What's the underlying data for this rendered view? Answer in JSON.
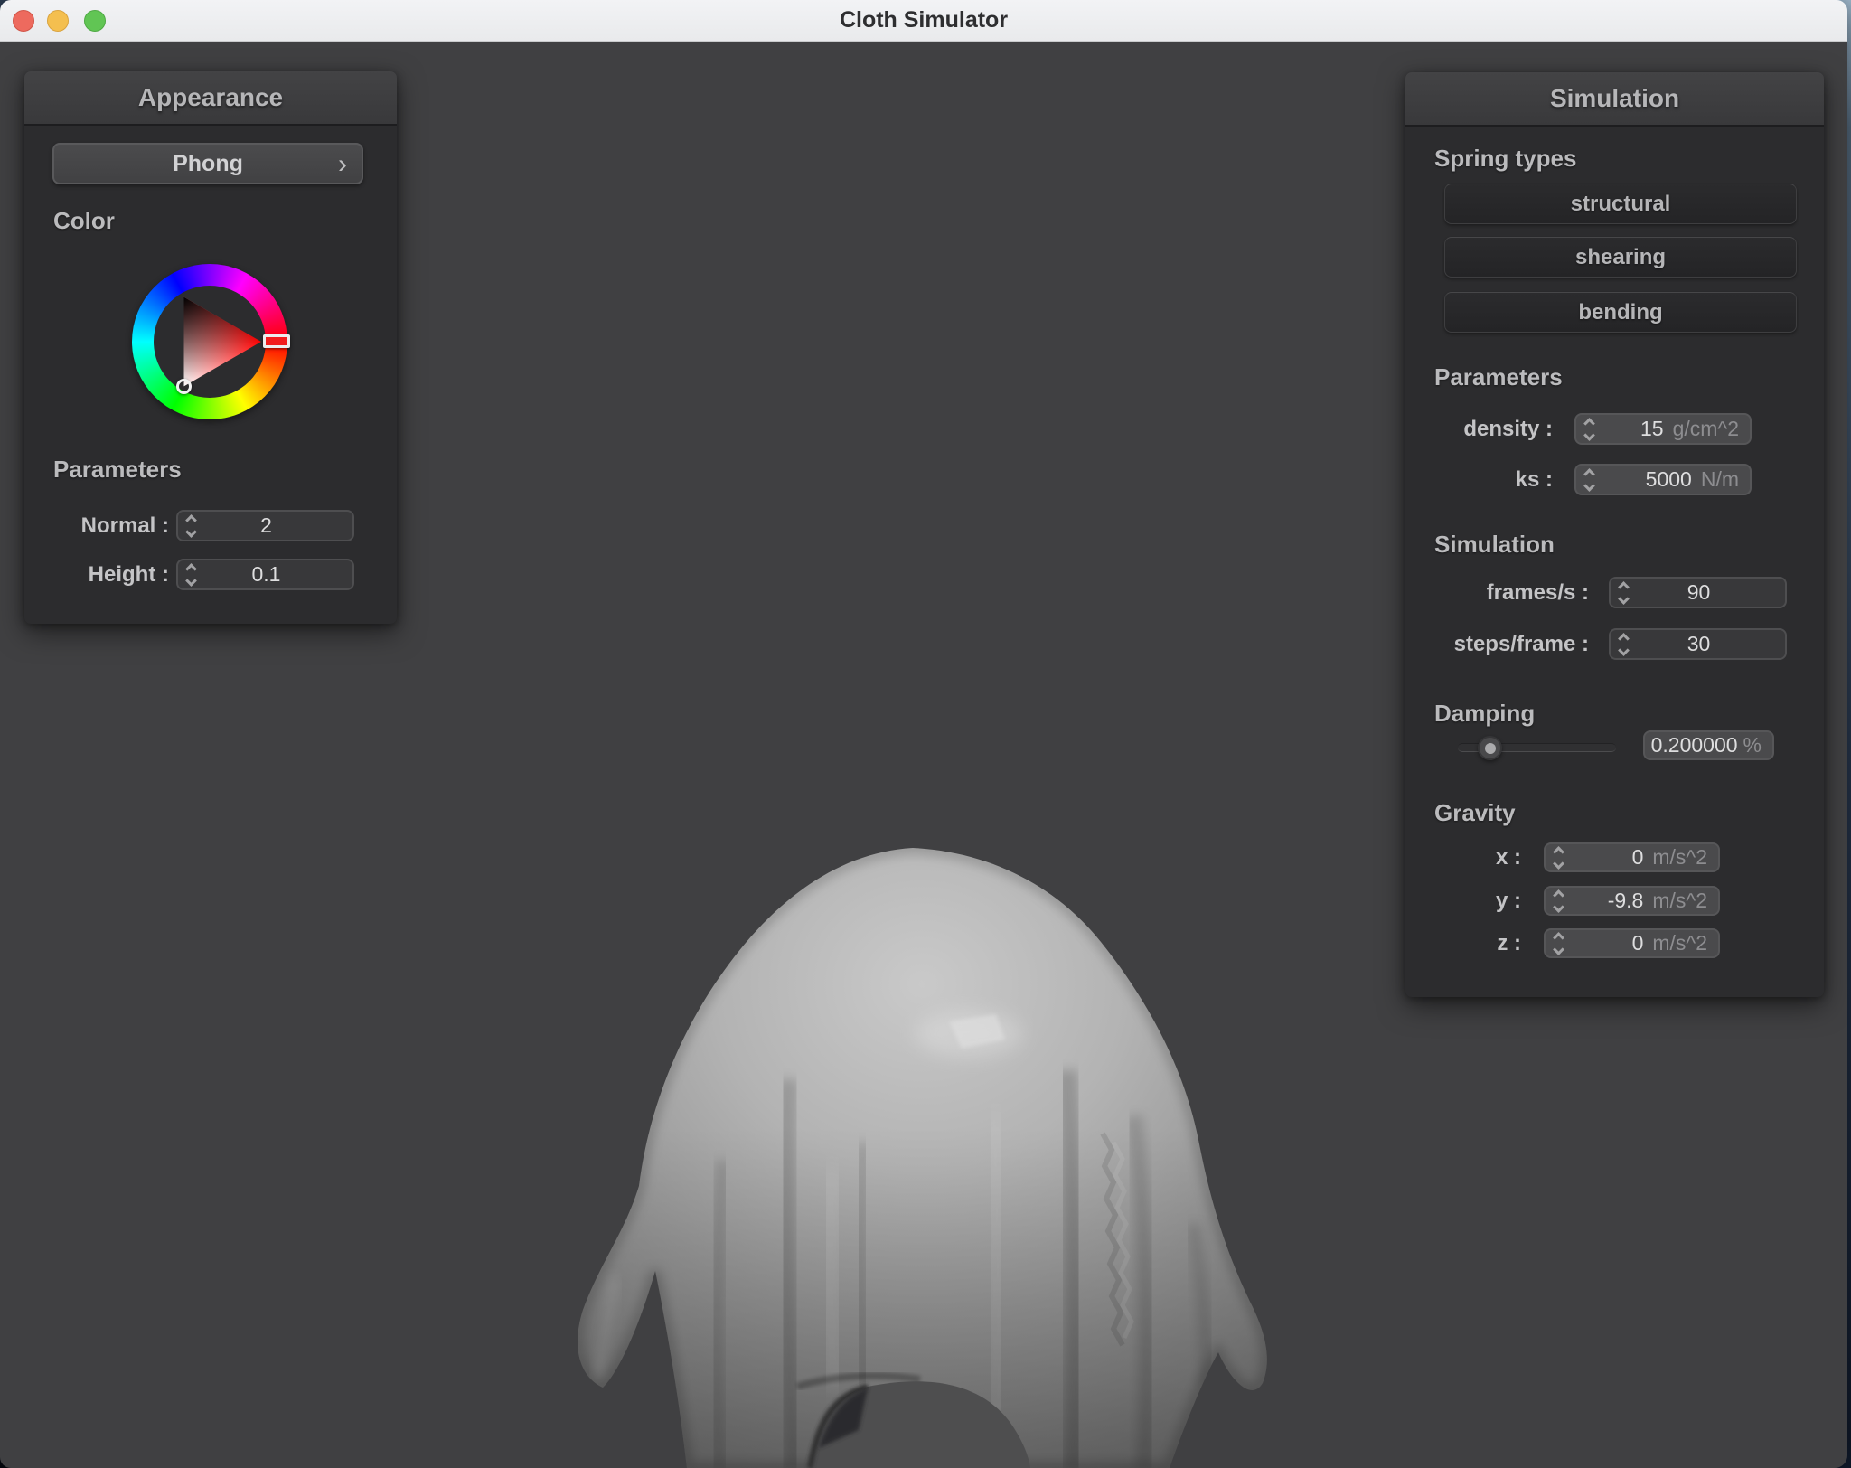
{
  "titlebar": {
    "title": "Cloth Simulator",
    "traffic_lights": {
      "close": "#ed6a5e",
      "minimize": "#f4bf4f",
      "zoom": "#61c554"
    }
  },
  "appearance": {
    "title": "Appearance",
    "shader": {
      "label": "Phong",
      "chevron": "›"
    },
    "color_label": "Color",
    "color_picker": {
      "selected_hue_color": "#f21d1d",
      "triangle_corners": [
        "hue",
        "black",
        "white"
      ]
    },
    "parameters_label": "Parameters",
    "normal": {
      "label": "Normal :",
      "value": "2"
    },
    "height": {
      "label": "Height :",
      "value": "0.1"
    }
  },
  "simulation": {
    "title": "Simulation",
    "spring_types_label": "Spring types",
    "spring_buttons": [
      {
        "label": "structural"
      },
      {
        "label": "shearing"
      },
      {
        "label": "bending"
      }
    ],
    "parameters_label": "Parameters",
    "density": {
      "label": "density :",
      "value": "15",
      "unit": "g/cm^2"
    },
    "ks": {
      "label": "ks :",
      "value": "5000",
      "unit": "N/m"
    },
    "simulation_label": "Simulation",
    "frames": {
      "label": "frames/s :",
      "value": "90"
    },
    "steps": {
      "label": "steps/frame :",
      "value": "30"
    },
    "damping_label": "Damping",
    "damping": {
      "value": "0.200000",
      "unit": "%",
      "slider_percent": 20
    },
    "gravity_label": "Gravity",
    "gravity_x": {
      "label": "x :",
      "value": "0",
      "unit": "m/s^2"
    },
    "gravity_y": {
      "label": "y :",
      "value": "-9.8",
      "unit": "m/s^2"
    },
    "gravity_z": {
      "label": "z :",
      "value": "0",
      "unit": "m/s^2"
    }
  },
  "viewport": {
    "description": "gray cloth draped over a sphere"
  }
}
